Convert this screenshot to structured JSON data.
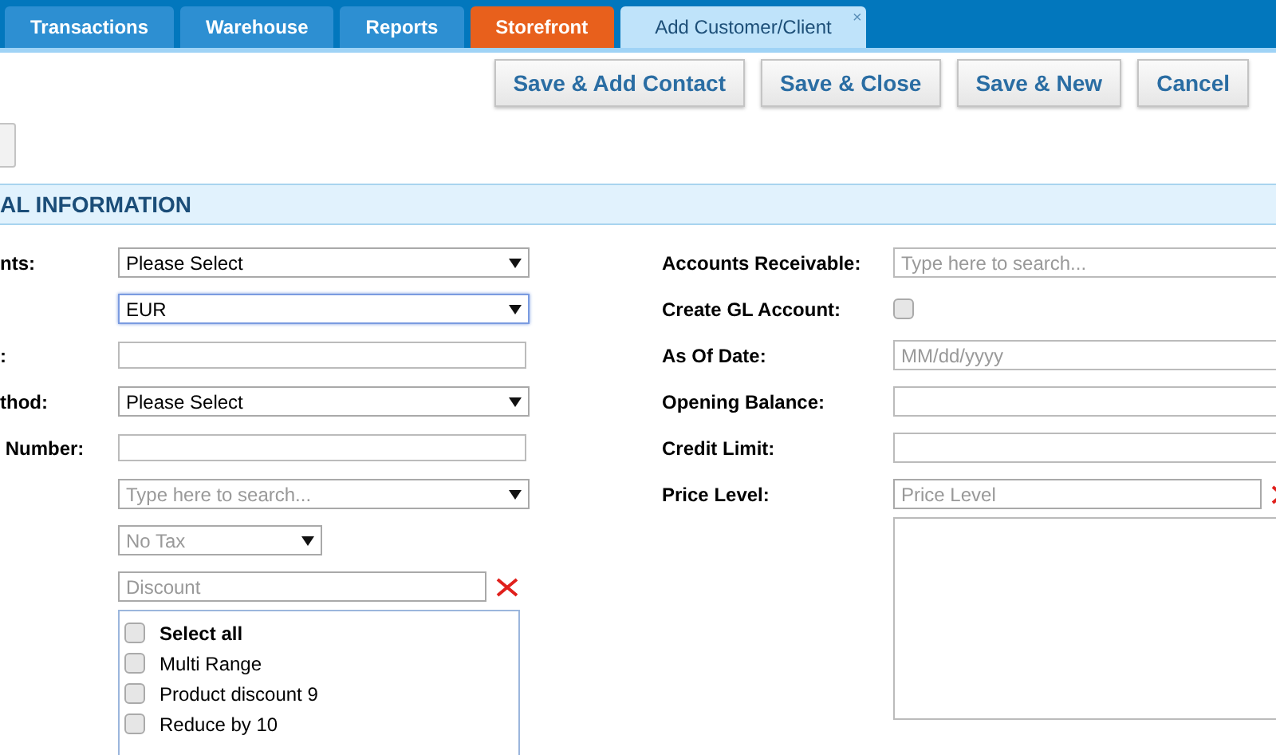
{
  "tabs": [
    {
      "label": "Transactions",
      "kind": "nav",
      "selected": false
    },
    {
      "label": "Warehouse",
      "kind": "nav",
      "selected": false
    },
    {
      "label": "Reports",
      "kind": "nav",
      "selected": false
    },
    {
      "label": "Storefront",
      "kind": "highlight",
      "selected": false
    },
    {
      "label": "Add Customer/Client",
      "kind": "document",
      "selected": true,
      "close": "×"
    }
  ],
  "actions": [
    "Save & Add Contact",
    "Save & Close",
    "Save & New",
    "Cancel"
  ],
  "section": {
    "title": "AL INFORMATION"
  },
  "left_fields": [
    {
      "label": "nts:",
      "kind": "select",
      "value": "Please Select",
      "focused": false
    },
    {
      "kind": "select",
      "value": "EUR",
      "focused": true
    },
    {
      "label": ":",
      "kind": "input"
    },
    {
      "label": "thod:",
      "kind": "select",
      "value": "Please Select",
      "focused": false
    },
    {
      "label": " Number:",
      "kind": "input"
    },
    {
      "kind": "search",
      "placeholder": "Type here to search..."
    },
    {
      "kind": "small-select",
      "placeholder": "No Tax"
    },
    {
      "kind": "discount",
      "placeholder": "Discount"
    }
  ],
  "discount_list": [
    {
      "label": "Select all",
      "bold": true,
      "checked": false
    },
    {
      "label": "Multi Range",
      "bold": false,
      "checked": false
    },
    {
      "label": "Product discount 9",
      "bold": false,
      "checked": false
    },
    {
      "label": "Reduce by 10",
      "bold": false,
      "checked": false
    }
  ],
  "right_fields": [
    {
      "label": "Accounts Receivable:",
      "kind": "input",
      "placeholder": "Type here to search..."
    },
    {
      "label": "Create GL Account:",
      "kind": "checkbox",
      "checked": false
    },
    {
      "label": "As Of Date:",
      "kind": "input",
      "placeholder": "MM/dd/yyyy"
    },
    {
      "label": "Opening Balance:",
      "kind": "input"
    },
    {
      "label": "Credit Limit:",
      "kind": "input"
    },
    {
      "label": "Price Level:",
      "kind": "price",
      "placeholder": "Price Level"
    }
  ]
}
